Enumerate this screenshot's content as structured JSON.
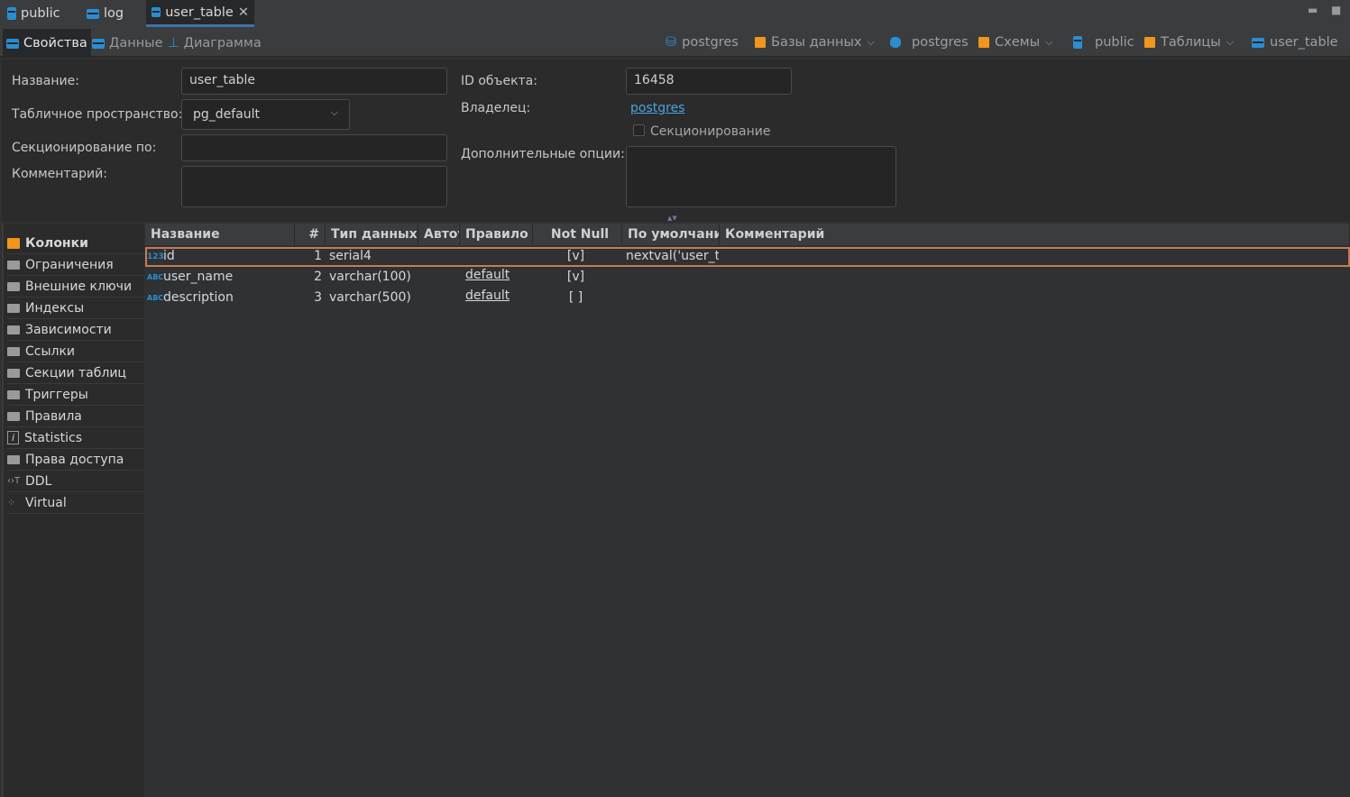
{
  "tabs": [
    {
      "label": "public",
      "icon": "schema-icon"
    },
    {
      "label": "log",
      "icon": "table-icon"
    },
    {
      "label": "user_table",
      "icon": "table-icon",
      "active": true,
      "closable": true
    }
  ],
  "subtabs": [
    {
      "label": "Свойства",
      "active": true
    },
    {
      "label": "Данные"
    },
    {
      "label": "Диаграмма"
    }
  ],
  "breadcrumb": [
    "postgres",
    "Базы данных",
    "postgres",
    "Схемы",
    "public",
    "Таблицы",
    "user_table"
  ],
  "form": {
    "name_label": "Название:",
    "name_value": "user_table",
    "tablespace_label": "Табличное пространство:",
    "tablespace_value": "pg_default",
    "partition_by_label": "Секционирование по:",
    "partition_by_value": "",
    "comment_label": "Комментарий:",
    "comment_value": "",
    "oid_label": "ID объекта:",
    "oid_value": "16458",
    "owner_label": "Владелец:",
    "owner_value": "postgres",
    "partitioning_checkbox": "Секционирование",
    "partitioning_checked": false,
    "extra_options_label": "Дополнительные опции:",
    "extra_options_value": ""
  },
  "sidebar": {
    "items": [
      {
        "label": "Колонки",
        "active": true
      },
      {
        "label": "Ограничения"
      },
      {
        "label": "Внешние ключи"
      },
      {
        "label": "Индексы"
      },
      {
        "label": "Зависимости"
      },
      {
        "label": "Ссылки"
      },
      {
        "label": "Секции таблиц"
      },
      {
        "label": "Триггеры"
      },
      {
        "label": "Правила"
      },
      {
        "label": "Statistics"
      },
      {
        "label": "Права доступа"
      },
      {
        "label": "DDL"
      },
      {
        "label": "Virtual"
      }
    ]
  },
  "columns": {
    "headers": [
      "Название",
      "#",
      "Тип данных",
      "Автоувеличение",
      "Правило сортировки",
      "Not Null",
      "По умолчанию",
      "Комментарий"
    ],
    "rows": [
      {
        "name": "id",
        "num": "1",
        "type": "serial4",
        "auto": "",
        "collation": "",
        "not_null": "[v]",
        "default": "nextval('user_table_id_seq'::regclass)",
        "comment": "",
        "icon": "123"
      },
      {
        "name": "user_name",
        "num": "2",
        "type": "varchar(100)",
        "auto": "",
        "collation": "default",
        "not_null": "[v]",
        "default": "",
        "comment": "",
        "icon": "ABC"
      },
      {
        "name": "description",
        "num": "3",
        "type": "varchar(500)",
        "auto": "",
        "collation": "default",
        "not_null": "[ ]",
        "default": "",
        "comment": "",
        "icon": "ABC"
      }
    ]
  },
  "colors": {
    "accent": "#2a8ed1",
    "selection": "#c87a50",
    "link": "#4aa3df"
  }
}
